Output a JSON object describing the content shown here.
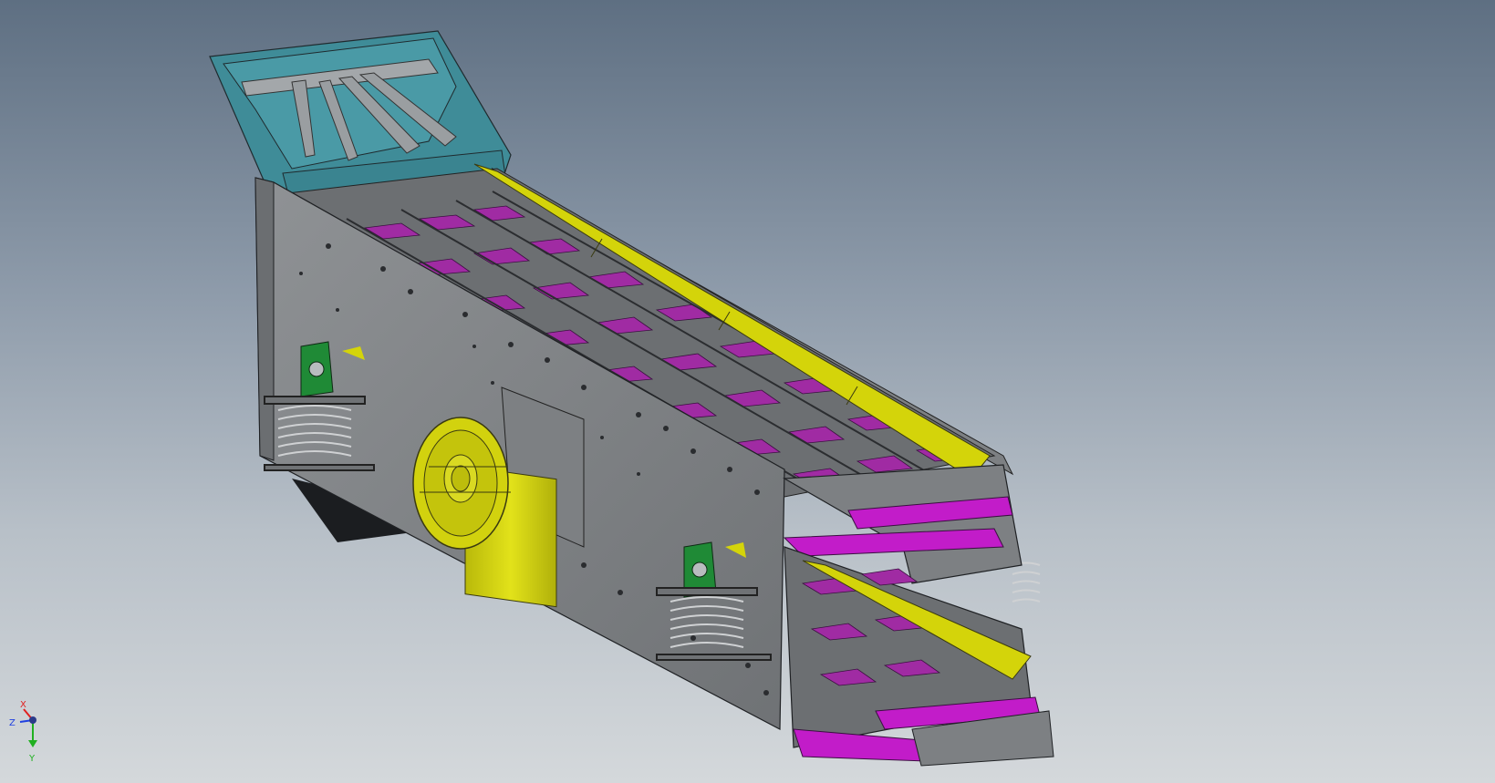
{
  "viewport": {
    "background_top": "#5e6f82",
    "background_bottom": "#d4d8db"
  },
  "model": {
    "colors": {
      "hopper": "#3f8c98",
      "frame": "#8a8d90",
      "liner": "#d4d40a",
      "screen_deck": "#a02ba3",
      "discharge_lip": "#c21cc9",
      "motor": "#d2d20e",
      "bearing_mount": "#1f8a36",
      "spring": "#a8aaad"
    },
    "components": [
      "hopper-icon",
      "side-frame-icon",
      "vibrator-motor-icon",
      "support-spring-icon",
      "bearing-mount-icon",
      "discharge-chute-icon"
    ]
  },
  "triad": {
    "x_label": "X",
    "y_label": "Y",
    "z_label": "Z",
    "x_color": "#e02020",
    "y_color": "#20b020",
    "z_color": "#2040e0"
  }
}
